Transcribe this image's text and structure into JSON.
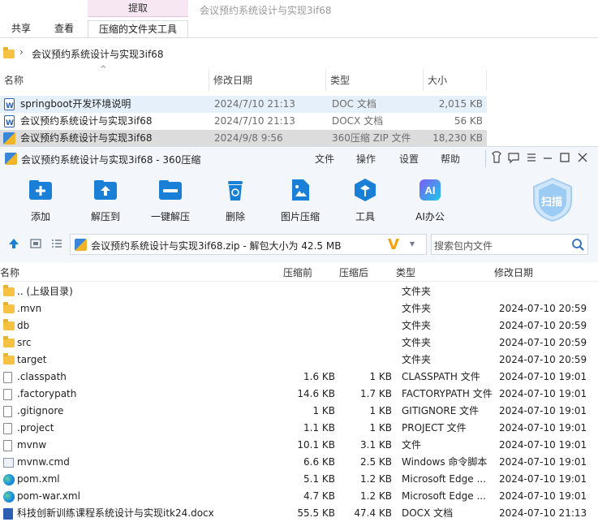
{
  "explorer": {
    "context_tab": "提取",
    "window_title": "会议预约系统设计与实现3if68",
    "tabs": [
      "共享",
      "查看",
      "压缩的文件夹工具"
    ],
    "address": "会议预约系统设计与实现3if68",
    "columns": [
      "名称",
      "修改日期",
      "类型",
      "大小"
    ],
    "rows": [
      {
        "name": "springboot开发环境说明",
        "date": "2024/7/10 21:13",
        "type": "DOC 文档",
        "size": "2,015 KB",
        "icon": "word-doc-icon"
      },
      {
        "name": "会议预约系统设计与实现3if68",
        "date": "2024/7/10 21:13",
        "type": "DOCX 文档",
        "size": "56 KB",
        "icon": "word-doc-icon"
      },
      {
        "name": "会议预约系统设计与实现3if68",
        "date": "2024/9/8 9:56",
        "type": "360压缩 ZIP 文件",
        "size": "18,230 KB",
        "icon": "zip-icon"
      }
    ]
  },
  "zip": {
    "title": "会议预约系统设计与实现3if68 - 360压缩",
    "menu": [
      "文件",
      "操作",
      "设置",
      "帮助"
    ],
    "tools": [
      "添加",
      "解压到",
      "一键解压",
      "删除",
      "图片压缩",
      "工具",
      "AI办公"
    ],
    "scan_label": "扫描",
    "path": "会议预约系统设计与实现3if68.zip - 解包大小为 42.5 MB",
    "search_placeholder": "搜索包内文件",
    "columns": [
      "名称",
      "压缩前",
      "压缩后",
      "类型",
      "修改日期"
    ],
    "rows": [
      {
        "name": ".. (上级目录)",
        "before": "",
        "after": "",
        "type": "文件夹",
        "date": "",
        "icon": "folder"
      },
      {
        "name": ".mvn",
        "before": "",
        "after": "",
        "type": "文件夹",
        "date": "2024-07-10 20:59",
        "icon": "folder"
      },
      {
        "name": "db",
        "before": "",
        "after": "",
        "type": "文件夹",
        "date": "2024-07-10 20:59",
        "icon": "folder"
      },
      {
        "name": "src",
        "before": "",
        "after": "",
        "type": "文件夹",
        "date": "2024-07-10 20:59",
        "icon": "folder"
      },
      {
        "name": "target",
        "before": "",
        "after": "",
        "type": "文件夹",
        "date": "2024-07-10 20:59",
        "icon": "folder"
      },
      {
        "name": ".classpath",
        "before": "1.6 KB",
        "after": "1 KB",
        "type": "CLASSPATH 文件",
        "date": "2024-07-10 19:01",
        "icon": "file"
      },
      {
        "name": ".factorypath",
        "before": "14.6 KB",
        "after": "1.7 KB",
        "type": "FACTORYPATH 文件",
        "date": "2024-07-10 19:01",
        "icon": "file"
      },
      {
        "name": ".gitignore",
        "before": "1 KB",
        "after": "1 KB",
        "type": "GITIGNORE 文件",
        "date": "2024-07-10 19:01",
        "icon": "file"
      },
      {
        "name": ".project",
        "before": "1.1 KB",
        "after": "1 KB",
        "type": "PROJECT 文件",
        "date": "2024-07-10 19:01",
        "icon": "file"
      },
      {
        "name": "mvnw",
        "before": "10.1 KB",
        "after": "3.1 KB",
        "type": "文件",
        "date": "2024-07-10 19:01",
        "icon": "file"
      },
      {
        "name": "mvnw.cmd",
        "before": "6.6 KB",
        "after": "2.5 KB",
        "type": "Windows 命令脚本",
        "date": "2024-07-10 19:01",
        "icon": "cmd"
      },
      {
        "name": "pom.xml",
        "before": "5.1 KB",
        "after": "1.2 KB",
        "type": "Microsoft Edge ...",
        "date": "2024-07-10 19:01",
        "icon": "edge"
      },
      {
        "name": "pom-war.xml",
        "before": "4.7 KB",
        "after": "1.2 KB",
        "type": "Microsoft Edge ...",
        "date": "2024-07-10 19:01",
        "icon": "edge"
      },
      {
        "name": "科技创新训练课程系统设计与实现itk24.docx",
        "before": "55.5 KB",
        "after": "47.4 KB",
        "type": "DOCX 文档",
        "date": "2024-07-10 21:13",
        "icon": "docx"
      }
    ]
  },
  "colors": {
    "accent": "#1a7fd6",
    "selected_row": "#cfe4f7",
    "highlight_row": "#dcdcdc",
    "folder": "#f5c244"
  }
}
